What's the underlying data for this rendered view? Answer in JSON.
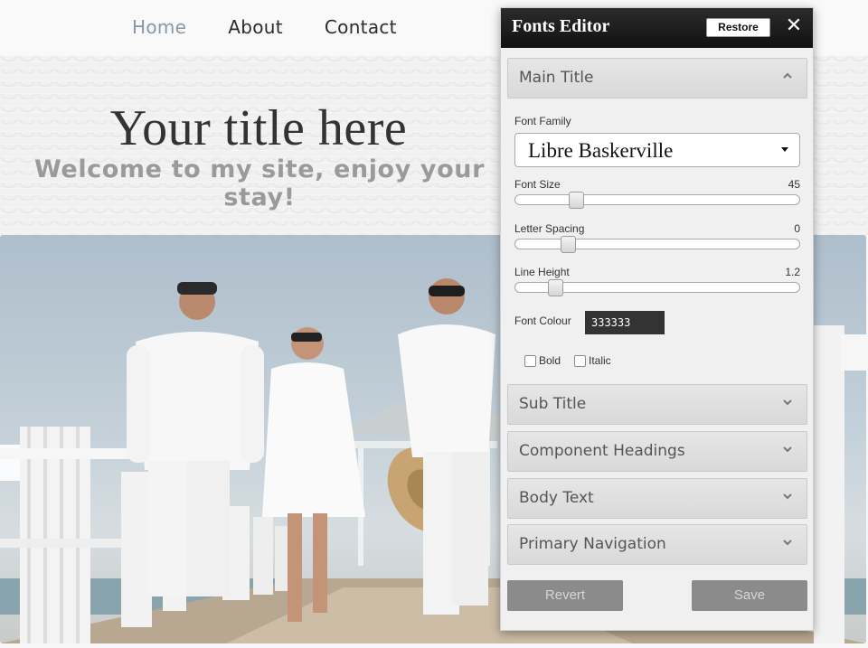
{
  "nav": {
    "items": [
      {
        "label": "Home",
        "active": true
      },
      {
        "label": "About",
        "active": false
      },
      {
        "label": "Contact",
        "active": false
      }
    ]
  },
  "hero": {
    "title": "Your title here",
    "subtitle": "Welcome to my site, enjoy your stay!"
  },
  "editor": {
    "title": "Fonts Editor",
    "restore_label": "Restore",
    "close_glyph": "✕",
    "sections": [
      {
        "label": "Main Title",
        "expanded": true
      },
      {
        "label": "Sub Title",
        "expanded": false
      },
      {
        "label": "Component Headings",
        "expanded": false
      },
      {
        "label": "Body Text",
        "expanded": false
      },
      {
        "label": "Primary Navigation",
        "expanded": false
      }
    ],
    "font_family": {
      "label": "Font Family",
      "value": "Libre Baskerville"
    },
    "font_size": {
      "label": "Font Size",
      "value": "45",
      "level": 0.2
    },
    "letter_spacing": {
      "label": "Letter Spacing",
      "value": "0",
      "level": 0.17
    },
    "line_height": {
      "label": "Line Height",
      "value": "1.2",
      "level": 0.12
    },
    "font_colour": {
      "label": "Font Colour",
      "value": "333333"
    },
    "bold": {
      "label": "Bold",
      "checked": false
    },
    "italic": {
      "label": "Italic",
      "checked": false
    },
    "revert_label": "Revert",
    "save_label": "Save"
  },
  "colors": {
    "nav_active": "#8797a6",
    "title": "#333333",
    "subtitle": "#9a9a9a",
    "editor_header": "#1a1a1a",
    "footer_button": "#8b8b8b"
  },
  "icons": {
    "collapse": "chevron-up-icon",
    "expand": "chevron-down-icon",
    "close": "close-icon",
    "dropdown": "caret-down-icon"
  }
}
